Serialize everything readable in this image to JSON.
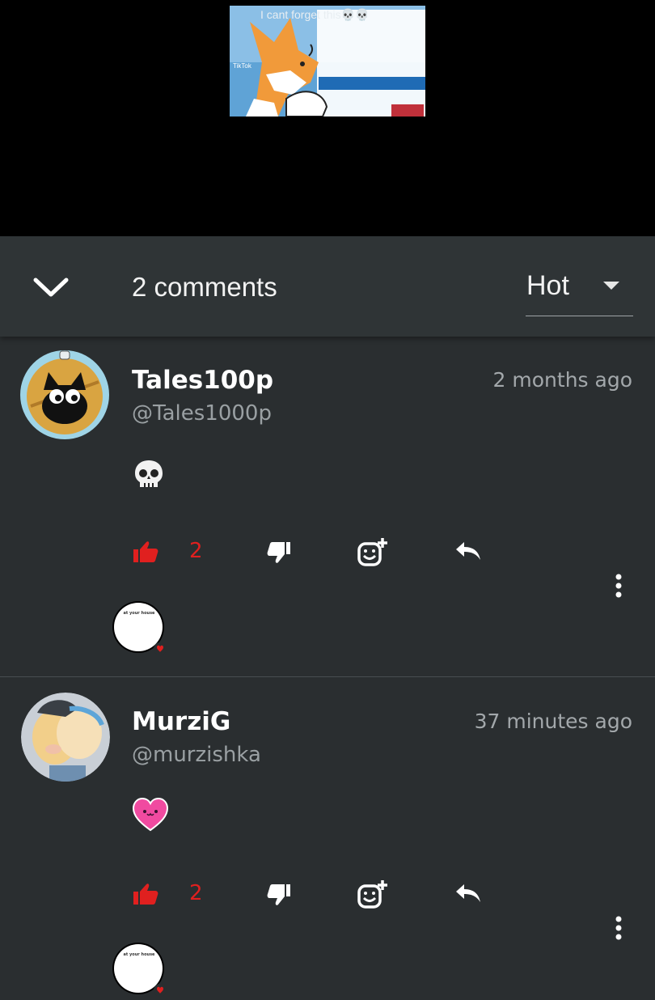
{
  "video": {
    "caption": "I cant forget this💀💀",
    "watermark": "TikTok"
  },
  "header": {
    "comment_count": "2 comments",
    "sort_label": "Hot"
  },
  "comments": [
    {
      "author": "Tales100p",
      "handle": "@Tales1000p",
      "time": "2 months ago",
      "emoji_icon": "skull-emoji",
      "likes": "2",
      "reactor_text": "at your house"
    },
    {
      "author": "MurziG",
      "handle": "@murzishka",
      "time": "37 minutes ago",
      "emoji_icon": "pink-heart-face-emoji",
      "likes": "2",
      "reactor_text": "at your house"
    }
  ],
  "colors": {
    "background": "#2a2e30",
    "header": "#2f3436",
    "like_active": "#e0201f",
    "secondary_text": "#9aa0a3"
  }
}
